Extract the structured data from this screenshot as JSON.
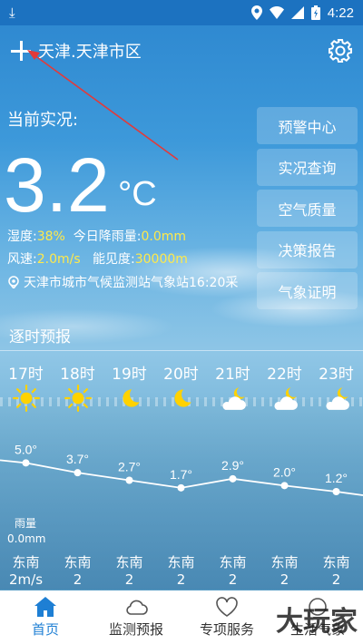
{
  "status_bar": {
    "time": "4:22"
  },
  "header": {
    "city": "天津.天津市区"
  },
  "current": {
    "label": "当前实况:",
    "temperature": "3.2",
    "unit": "°C",
    "humidity_label": "湿度:",
    "humidity_value": "38%",
    "rain_label": "今日降雨量:",
    "rain_value": "0.0mm",
    "wind_label": "风速:",
    "wind_value": "2.0m/s",
    "visibility_label": "能见度:",
    "visibility_value": "30000m",
    "station": "天津市城市气候监测站气象站16:20采"
  },
  "side_buttons": [
    "预警中心",
    "实况查询",
    "空气质量",
    "决策报告",
    "气象证明"
  ],
  "hourly": {
    "title": "逐时预报",
    "hours": [
      "17时",
      "18时",
      "19时",
      "20时",
      "21时",
      "22时",
      "23时"
    ],
    "icons": [
      "sun-icon",
      "sun-icon",
      "moon-icon",
      "moon-icon",
      "cloudy-night-icon",
      "cloudy-night-icon",
      "cloudy-night-icon"
    ],
    "rain_label": "雨量",
    "rain_value": "0.0mm",
    "wind_dirs": [
      "东南",
      "东南",
      "东南",
      "东南",
      "东南",
      "东南",
      "东南"
    ],
    "wind_speeds": [
      "2m/s",
      "2",
      "2",
      "2",
      "2",
      "2",
      "2"
    ]
  },
  "chart_data": {
    "type": "line",
    "categories": [
      "17时",
      "18时",
      "19时",
      "20时",
      "21时",
      "22时",
      "23时"
    ],
    "values": [
      5.0,
      3.7,
      2.7,
      1.7,
      2.9,
      2.0,
      1.2
    ],
    "labels": [
      "5.0°",
      "3.7°",
      "2.7°",
      "1.7°",
      "2.9°",
      "2.0°",
      "1.2°"
    ],
    "ylim": [
      0,
      6
    ]
  },
  "bottom_nav": [
    "首页",
    "监测预报",
    "专项服务",
    "生活气象"
  ],
  "watermark": "大玩家",
  "colors": {
    "accent": "#1e7fd4",
    "highlight": "#ffe94a",
    "status_bar": "#1c72c0"
  }
}
